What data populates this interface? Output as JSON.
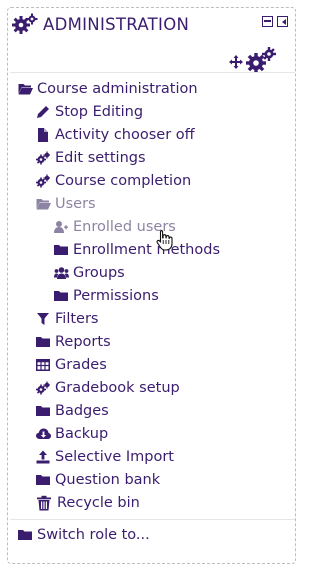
{
  "block": {
    "title": "ADMINISTRATION",
    "header_icons": [
      "gears-icon",
      "minimize-icon",
      "dock-icon",
      "move-icon",
      "gears-icon"
    ]
  },
  "tree": {
    "course_admin": "Course administration",
    "items": [
      {
        "label": "Stop Editing",
        "icon": "pencil-icon"
      },
      {
        "label": "Activity chooser off",
        "icon": "file-icon"
      },
      {
        "label": "Edit settings",
        "icon": "gears-icon"
      },
      {
        "label": "Course completion",
        "icon": "gears-icon"
      },
      {
        "label": "Users",
        "icon": "folder-open-icon"
      },
      {
        "label": "Enrolled users",
        "icon": "user-plus-icon"
      },
      {
        "label": "Enrollment methods",
        "icon": "folder-icon"
      },
      {
        "label": "Groups",
        "icon": "users-icon"
      },
      {
        "label": "Permissions",
        "icon": "folder-icon"
      },
      {
        "label": "Filters",
        "icon": "filter-icon"
      },
      {
        "label": "Reports",
        "icon": "folder-icon"
      },
      {
        "label": "Grades",
        "icon": "table-icon"
      },
      {
        "label": "Gradebook setup",
        "icon": "gears-icon"
      },
      {
        "label": "Badges",
        "icon": "folder-icon"
      },
      {
        "label": "Backup",
        "icon": "cloud-download-icon"
      },
      {
        "label": "Selective Import",
        "icon": "upload-icon"
      },
      {
        "label": "Question bank",
        "icon": "folder-icon"
      },
      {
        "label": "Recycle bin",
        "icon": "trash-icon"
      }
    ],
    "switch_role": "Switch role to..."
  },
  "colors": {
    "text": "#3a1d6e",
    "muted": "#8d84a3",
    "border": "#bdbdbd"
  }
}
